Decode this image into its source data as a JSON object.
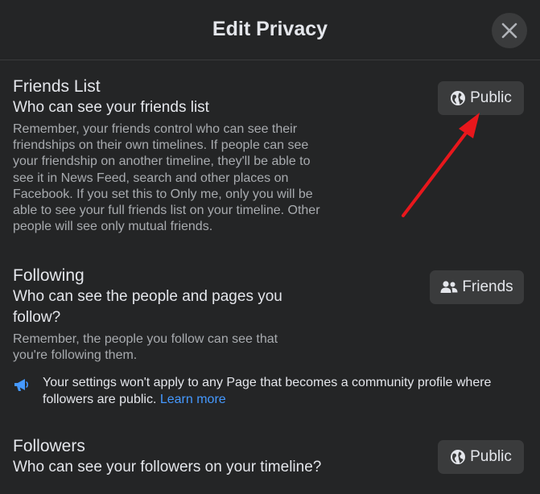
{
  "dialog": {
    "title": "Edit Privacy"
  },
  "icons": {
    "close": "close-icon",
    "globe": "globe-icon",
    "friends": "friends-icon",
    "megaphone": "megaphone-icon"
  },
  "colors": {
    "background": "#242526",
    "button_bg": "#3a3b3c",
    "link": "#4599ff",
    "arrow": "#e8171c"
  },
  "friends_list": {
    "title": "Friends List",
    "subtitle": "Who can see your friends list",
    "description": "Remember, your friends control who can see their friendships on their own timelines. If people can see your friendship on another timeline, they'll be able to see it in News Feed, search and other places on Facebook. If you set this to Only me, only you will be able to see your full friends list on your timeline. Other people will see only mutual friends.",
    "audience": "Public"
  },
  "following": {
    "title": "Following",
    "subtitle": "Who can see the people and pages you follow?",
    "description": "Remember, the people you follow can see that you're following them.",
    "audience": "Friends"
  },
  "notice": {
    "text": "Your settings won't apply to any Page that becomes a community profile where followers are public.",
    "link": "Learn more"
  },
  "followers": {
    "title": "Followers",
    "subtitle": "Who can see your followers on your timeline?",
    "audience": "Public"
  }
}
